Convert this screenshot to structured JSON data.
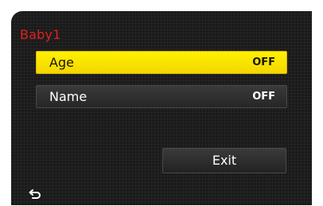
{
  "colors": {
    "title_red": "#e0201a",
    "highlight_yellow": "#fff000",
    "panel_bg": "#1a1a1a"
  },
  "menu": {
    "title": "Baby1",
    "items": [
      {
        "label": "Age",
        "value": "OFF",
        "selected": true
      },
      {
        "label": "Name",
        "value": "OFF",
        "selected": false
      }
    ],
    "exit_label": "Exit",
    "back_icon": "return-arrow-icon"
  }
}
